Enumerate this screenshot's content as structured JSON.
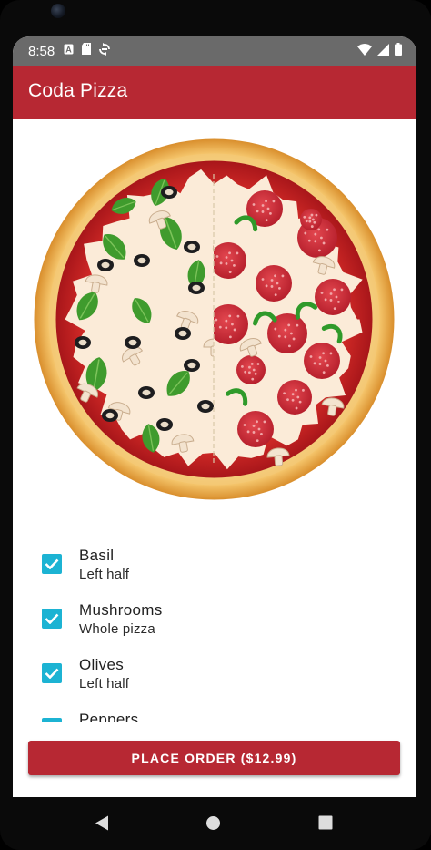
{
  "status_bar": {
    "time": "8:58",
    "icons": [
      "a-letter-icon",
      "sd-card-icon",
      "sync-icon"
    ],
    "right_icons": [
      "wifi-icon",
      "signal-icon",
      "battery-icon"
    ]
  },
  "app": {
    "title": "Coda Pizza",
    "accent_color": "#b72833",
    "checkbox_color": "#1cb3d3"
  },
  "pizza": {
    "left_half_toppings": [
      "Basil",
      "Mushrooms",
      "Olives"
    ],
    "right_half_toppings": [
      "Pepperoni",
      "Peppers",
      "Mushrooms"
    ]
  },
  "toppings": [
    {
      "name": "Basil",
      "placement": "Left half",
      "checked": true
    },
    {
      "name": "Mushrooms",
      "placement": "Whole pizza",
      "checked": true
    },
    {
      "name": "Olives",
      "placement": "Left half",
      "checked": true
    },
    {
      "name": "Peppers",
      "placement": "",
      "checked": true
    }
  ],
  "order_button": {
    "label": "PLACE ORDER ($12.99)"
  },
  "nav_bar": {
    "buttons": [
      "back-icon",
      "home-icon",
      "recents-icon"
    ]
  }
}
